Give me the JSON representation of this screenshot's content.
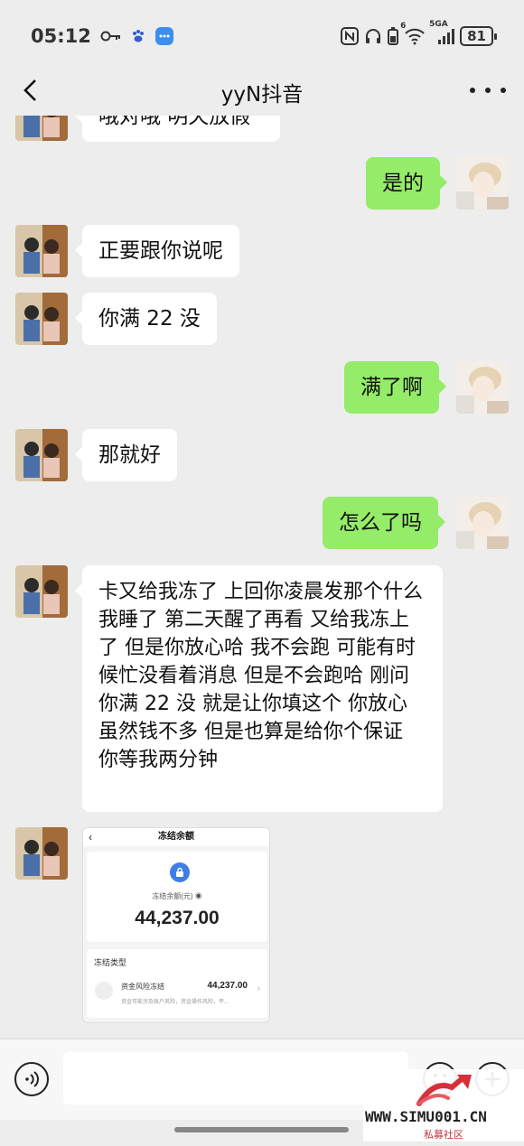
{
  "status_bar": {
    "time": "05:12",
    "network": "5GA",
    "wifi_badge": "6",
    "battery": "81",
    "left_icons": [
      "key-icon",
      "baidu-paw-icon",
      "chat-app-icon"
    ],
    "right_icons": [
      "nfc-icon",
      "headphones-icon",
      "battery-small-icon",
      "wifi-icon",
      "signal-icon"
    ]
  },
  "header": {
    "title": "yyN抖音",
    "back_icon": "chevron-left-icon",
    "more_icon": "more-dots-icon"
  },
  "messages": [
    {
      "side": "in",
      "text": "哦对哦 明天放假",
      "partial": true
    },
    {
      "side": "out",
      "text": "是的"
    },
    {
      "side": "in",
      "text": "正要跟你说呢"
    },
    {
      "side": "in",
      "text": "你满 22 没"
    },
    {
      "side": "out",
      "text": "满了啊"
    },
    {
      "side": "in",
      "text": "那就好"
    },
    {
      "side": "out",
      "text": "怎么了吗"
    },
    {
      "side": "in",
      "text": "卡又给我冻了  上回你凌晨发那个什么  我睡了  第二天醒了再看  又给我冻上了 但是你放心哈  我不会跑  可能有时候忙没看着消息  但是不会跑哈  刚问你满 22 没  就是让你填这个  你放心  虽然钱不多  但是也算是给你个保证    你等我两分钟"
    }
  ],
  "image_card": {
    "title": "冻结余额",
    "balance_label": "冻结余额(元)",
    "balance": "44,237.00",
    "type_label": "冻结类型",
    "row_name": "资金风险冻结",
    "row_amount": "44,237.00",
    "row_desc": "资金可能涉及账户风险，资金操作风险，平..."
  },
  "input_bar": {
    "placeholder": "",
    "icons": [
      "voice-icon",
      "emoji-icon",
      "plus-icon"
    ]
  },
  "watermark": {
    "url": "WWW.SIMU001.CN",
    "label": "私募社区"
  },
  "colors": {
    "background": "#ededed",
    "outgoing_bubble": "#95ec69",
    "incoming_bubble": "#ffffff",
    "lock_blue": "#3f7ee8",
    "watermark_red": "#c0333d"
  }
}
